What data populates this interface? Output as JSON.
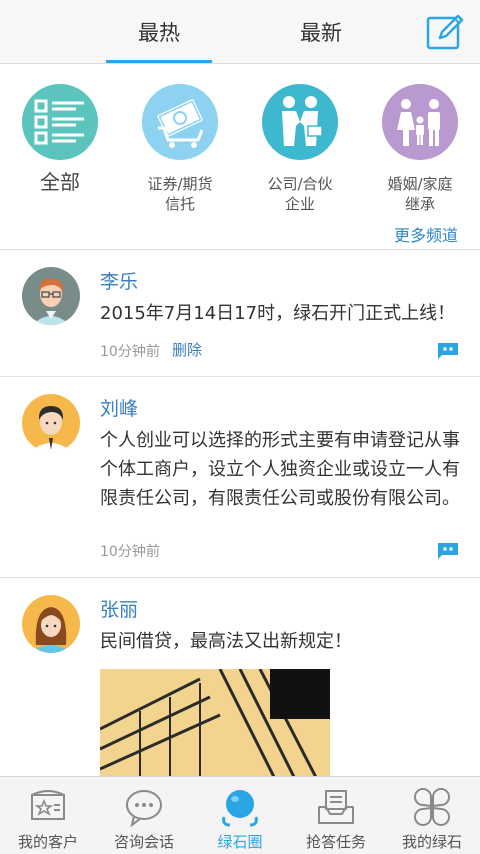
{
  "tabs": {
    "hot": "最热",
    "new": "最新"
  },
  "categories": [
    {
      "label": "全部",
      "icon": "list-icon",
      "color": "#5bc4bd"
    },
    {
      "label": "证券/期货信托",
      "line1": "证券/期货",
      "line2": "信托",
      "icon": "money-cart-icon",
      "color": "#8dd2f1"
    },
    {
      "label": "公司/合伙企业",
      "line1": "公司/合伙",
      "line2": "企业",
      "icon": "handshake-icon",
      "color": "#3eb8cf"
    },
    {
      "label": "婚姻/家庭继承",
      "line1": "婚姻/家庭",
      "line2": "继承",
      "icon": "family-icon",
      "color": "#b89ad0"
    }
  ],
  "more_channels": "更多频道",
  "posts": [
    {
      "name": "李乐",
      "text": "2015年7月14日17时，绿石开门正式上线！",
      "time": "10分钟前",
      "delete": "删除"
    },
    {
      "name": "刘峰",
      "text": "个人创业可以选择的形式主要有申请登记从事个体工商户，设立个人独资企业或设立一人有限责任公司，有限责任公司或股份有限公司。",
      "time": "10分钟前"
    },
    {
      "name": "张丽",
      "text": "民间借贷，最高法又出新规定！"
    }
  ],
  "nav": [
    {
      "label": "我的客户",
      "icon": "customer-card-icon"
    },
    {
      "label": "咨询会话",
      "icon": "chat-bubble-icon"
    },
    {
      "label": "绿石圈",
      "icon": "green-stone-circle-icon",
      "active": true
    },
    {
      "label": "抢答任务",
      "icon": "task-inbox-icon"
    },
    {
      "label": "我的绿石",
      "icon": "clover-icon"
    }
  ],
  "colors": {
    "accent": "#2aa6e3",
    "link": "#3a7fc0"
  }
}
